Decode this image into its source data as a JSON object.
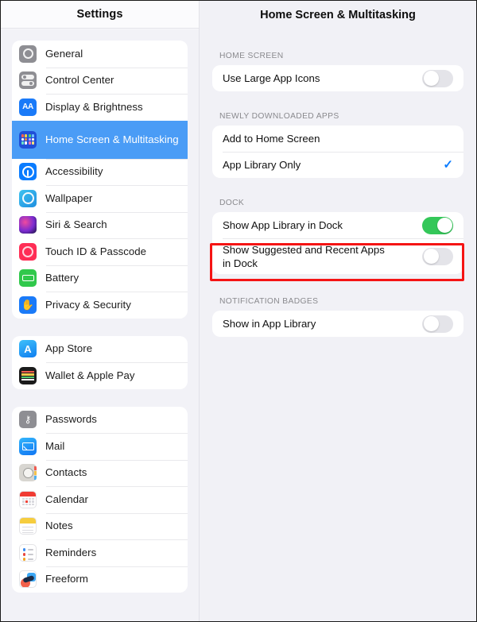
{
  "sidebar": {
    "header_title": "Settings",
    "groups": [
      {
        "items": [
          {
            "label": "General",
            "icon": "gear-icon",
            "selected": false
          },
          {
            "label": "Control Center",
            "icon": "control-center-icon",
            "selected": false
          },
          {
            "label": "Display & Brightness",
            "icon": "display-brightness-icon",
            "selected": false
          },
          {
            "label": "Home Screen & Multitasking",
            "icon": "home-screen-icon",
            "selected": true
          },
          {
            "label": "Accessibility",
            "icon": "accessibility-icon",
            "selected": false
          },
          {
            "label": "Wallpaper",
            "icon": "wallpaper-icon",
            "selected": false
          },
          {
            "label": "Siri & Search",
            "icon": "siri-icon",
            "selected": false
          },
          {
            "label": "Touch ID & Passcode",
            "icon": "touch-id-icon",
            "selected": false
          },
          {
            "label": "Battery",
            "icon": "battery-icon",
            "selected": false
          },
          {
            "label": "Privacy & Security",
            "icon": "privacy-hand-icon",
            "selected": false
          }
        ]
      },
      {
        "items": [
          {
            "label": "App Store",
            "icon": "app-store-icon",
            "selected": false
          },
          {
            "label": "Wallet & Apple Pay",
            "icon": "wallet-icon",
            "selected": false
          }
        ]
      },
      {
        "items": [
          {
            "label": "Passwords",
            "icon": "passwords-key-icon",
            "selected": false
          },
          {
            "label": "Mail",
            "icon": "mail-icon",
            "selected": false
          },
          {
            "label": "Contacts",
            "icon": "contacts-icon",
            "selected": false
          },
          {
            "label": "Calendar",
            "icon": "calendar-icon",
            "selected": false
          },
          {
            "label": "Notes",
            "icon": "notes-icon",
            "selected": false
          },
          {
            "label": "Reminders",
            "icon": "reminders-icon",
            "selected": false
          },
          {
            "label": "Freeform",
            "icon": "freeform-icon",
            "selected": false
          }
        ]
      }
    ]
  },
  "detail": {
    "header_title": "Home Screen & Multitasking",
    "sections": {
      "home_screen": {
        "title": "HOME SCREEN",
        "rows": [
          {
            "label": "Use Large App Icons",
            "control": "toggle",
            "value": "off"
          }
        ]
      },
      "newly_downloaded": {
        "title": "NEWLY DOWNLOADED APPS",
        "rows": [
          {
            "label": "Add to Home Screen",
            "control": "none",
            "value": ""
          },
          {
            "label": "App Library Only",
            "control": "check",
            "value": "selected"
          }
        ]
      },
      "dock": {
        "title": "DOCK",
        "rows": [
          {
            "label": "Show App Library in Dock",
            "control": "toggle",
            "value": "on"
          },
          {
            "label": "Show Suggested and Recent Apps in Dock",
            "control": "toggle",
            "value": "off",
            "highlighted": true
          }
        ]
      },
      "notification_badges": {
        "title": "NOTIFICATION BADGES",
        "rows": [
          {
            "label": "Show in App Library",
            "control": "toggle",
            "value": "off"
          }
        ]
      }
    }
  },
  "annotation": {
    "highlight_color": "#F51414",
    "shape": "rectangle"
  },
  "colors": {
    "accent_blue": "#0A7CFF",
    "selected_row": "#4A9CF6",
    "toggle_on_green": "#34C759",
    "toggle_off_gray": "#E4E4E9",
    "panel_background": "#F1F1F6",
    "card_background": "#FFFFFF",
    "section_title": "#8A8A8E",
    "highlight_red": "#F51414"
  },
  "icons": {
    "check_glyph": "✓",
    "hand_glyph": "✋",
    "key_glyph": "⚷",
    "appstore_glyph": "A"
  }
}
